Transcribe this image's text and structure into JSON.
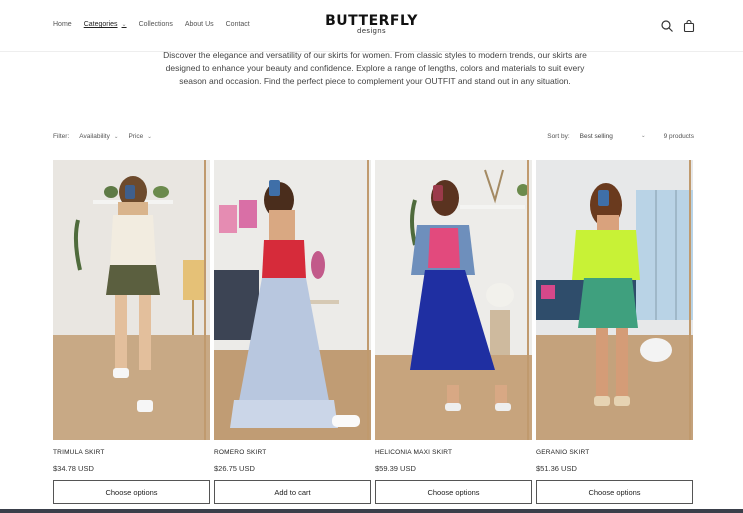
{
  "header": {
    "nav": [
      {
        "label": "Home",
        "active": false,
        "dropdown": false
      },
      {
        "label": "Categories",
        "active": true,
        "dropdown": true
      },
      {
        "label": "Collections",
        "active": false,
        "dropdown": false
      },
      {
        "label": "About Us",
        "active": false,
        "dropdown": false
      },
      {
        "label": "Contact",
        "active": false,
        "dropdown": false
      }
    ],
    "logo_main": "BUTTERFLY",
    "logo_sub": "designs",
    "icons": [
      "search-icon",
      "cart-icon"
    ]
  },
  "intro": {
    "text": "Discover the elegance and versatility of our skirts for women. From classic styles to modern trends, our skirts are designed to enhance your beauty and confidence. Explore a range of lengths, colors and materials to suit every season and occasion. Find the perfect piece to complement your OUTFIT and stand out in any situation."
  },
  "filters": {
    "label": "Filter:",
    "availability": "Availability",
    "price": "Price",
    "sort_label": "Sort by:",
    "sort_value": "Best selling",
    "count": "9 products"
  },
  "products": [
    {
      "name": "TRIMULA SKIRT",
      "price": "$34.78 USD",
      "button": "Choose options"
    },
    {
      "name": "ROMERO SKIRT",
      "price": "$26.75 USD",
      "button": "Add to cart"
    },
    {
      "name": "HELICONIA MAXI SKIRT",
      "price": "$59.39 USD",
      "button": "Choose options"
    },
    {
      "name": "GERANIO SKIRT",
      "price": "$51.36 USD",
      "button": "Choose options"
    }
  ],
  "colors": {
    "accent": "#111111",
    "border": "#555555",
    "bottom_bar": "#3a3f4a"
  }
}
